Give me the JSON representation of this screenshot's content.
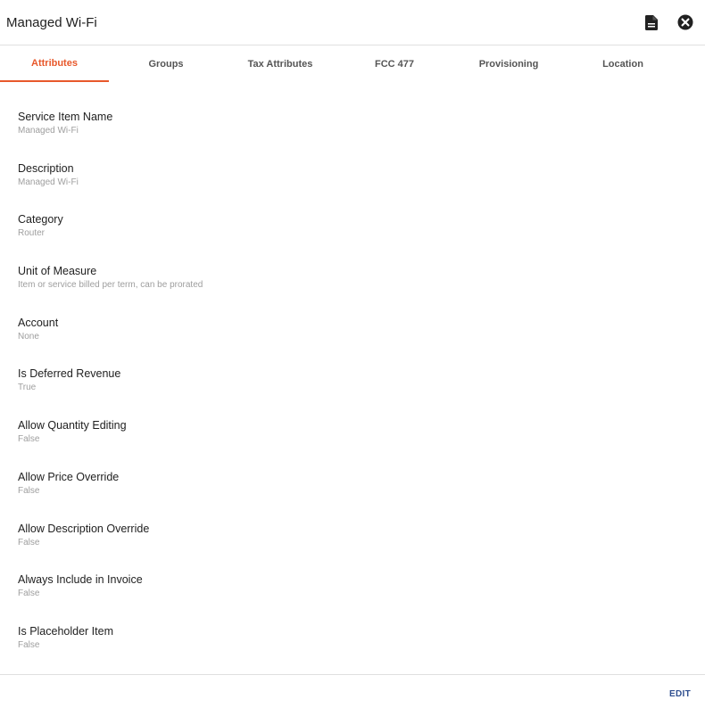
{
  "header": {
    "title": "Managed Wi-Fi",
    "doc_icon": "document-icon",
    "close_icon": "close-circle-icon"
  },
  "tabs": [
    {
      "label": "Attributes",
      "active": true
    },
    {
      "label": "Groups",
      "active": false
    },
    {
      "label": "Tax Attributes",
      "active": false
    },
    {
      "label": "FCC 477",
      "active": false
    },
    {
      "label": "Provisioning",
      "active": false
    },
    {
      "label": "Location",
      "active": false
    }
  ],
  "fields": [
    {
      "label": "Service Item Name",
      "value": "Managed Wi-Fi"
    },
    {
      "label": "Description",
      "value": "Managed Wi-Fi"
    },
    {
      "label": "Category",
      "value": "Router"
    },
    {
      "label": "Unit of Measure",
      "value": "Item or service billed per term, can be prorated"
    },
    {
      "label": "Account",
      "value": "None"
    },
    {
      "label": "Is Deferred Revenue",
      "value": "True"
    },
    {
      "label": "Allow Quantity Editing",
      "value": "False"
    },
    {
      "label": "Allow Price Override",
      "value": "False"
    },
    {
      "label": "Allow Description Override",
      "value": "False"
    },
    {
      "label": "Always Include in Invoice",
      "value": "False"
    },
    {
      "label": "Is Placeholder Item",
      "value": "False"
    }
  ],
  "footer": {
    "edit_label": "EDIT"
  },
  "colors": {
    "accent": "#e8582b",
    "edit": "#2f4f8f"
  }
}
